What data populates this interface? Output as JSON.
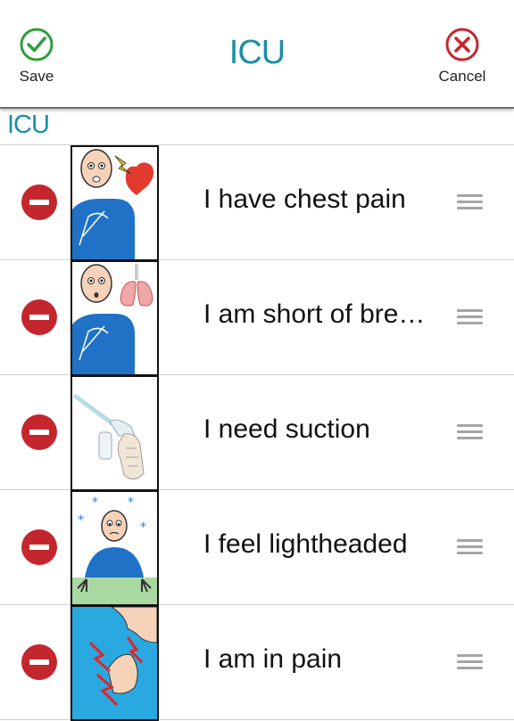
{
  "header": {
    "title": "ICU",
    "save_label": "Save",
    "cancel_label": "Cancel",
    "save_icon": "check-circle-icon",
    "cancel_icon": "x-circle-icon"
  },
  "section": {
    "label": "ICU"
  },
  "items": [
    {
      "phrase": "I have chest pain",
      "picture": "chest-pain-icon"
    },
    {
      "phrase": "I am short of bre…",
      "picture": "short-of-breath-icon"
    },
    {
      "phrase": "I need suction",
      "picture": "suction-icon"
    },
    {
      "phrase": "I feel lightheaded",
      "picture": "lightheaded-icon"
    },
    {
      "phrase": "I am in pain",
      "picture": "pain-icon"
    }
  ],
  "colors": {
    "accent": "#1a8fa6",
    "save_green": "#2e9e3a",
    "delete_red": "#c4262e",
    "shirt_blue": "#1f72c6"
  }
}
